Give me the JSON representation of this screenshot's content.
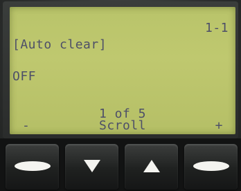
{
  "display": {
    "page_code": "1-1",
    "setting_title": "[Auto clear]",
    "setting_value": "OFF",
    "page_position": "1 of 5",
    "softkeys": {
      "left": "-",
      "center": "Scroll",
      "right": "+"
    }
  },
  "buttons": {
    "left_softkey_icon": "softkey-bar-icon",
    "down_icon": "arrow-down-icon",
    "up_icon": "arrow-up-icon",
    "right_softkey_icon": "softkey-bar-icon"
  },
  "colors": {
    "lcd_background": "#bac56b",
    "lcd_text": "#4d4f68",
    "button_glyph": "#f4f4f0"
  }
}
